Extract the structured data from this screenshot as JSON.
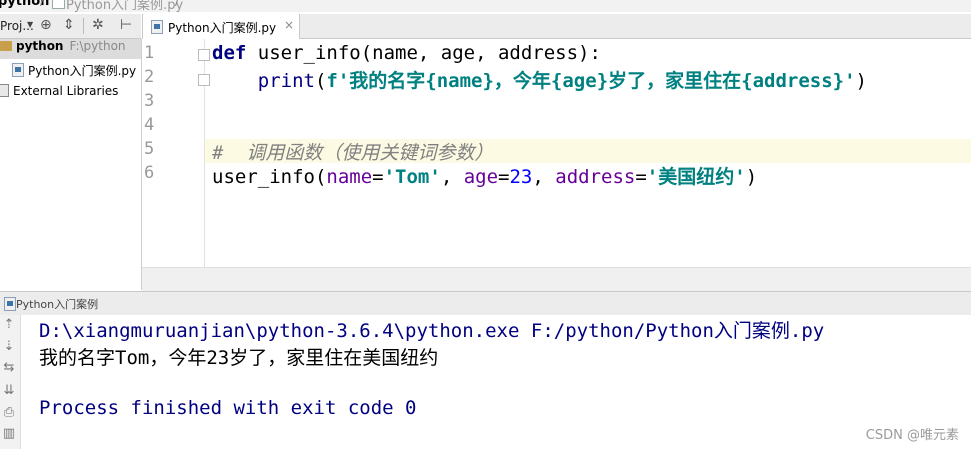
{
  "breadcrumb": {
    "root": "python",
    "separator": "/",
    "file": "Python入门案例.py"
  },
  "project_toolbar": {
    "label": "Proj...",
    "icons": [
      "target-icon",
      "collapse-icon",
      "gear-icon",
      "pin-icon"
    ]
  },
  "tree": {
    "root_name": "python",
    "root_path": "F:\\python",
    "file": "Python入门案例.py",
    "libraries": "External Libraries"
  },
  "editor_tab": {
    "label": "Python入门案例.py",
    "close": "×"
  },
  "editor": {
    "lines": [
      {
        "number": "1",
        "text": "def user_info(name, age, address):"
      },
      {
        "number": "2",
        "text": "    print(f'我的名字{name}，今年{age}岁了，家里住在{address}')"
      },
      {
        "number": "3",
        "text": ""
      },
      {
        "number": "4",
        "text": ""
      },
      {
        "number": "5",
        "text": "#  调用函数（使用关键词参数）"
      },
      {
        "number": "6",
        "text": "user_info(name='Tom', age=23, address='美国纽约')"
      }
    ]
  },
  "run_panel": {
    "title": "Python入门案例",
    "buttons": [
      "up-arrow-icon",
      "down-arrow-icon",
      "wrap-icon",
      "scroll-end-icon",
      "print-icon",
      "trash-icon"
    ],
    "output": [
      "D:\\xiangmuruanjian\\python-3.6.4\\python.exe F:/python/Python入门案例.py",
      "我的名字Tom，今年23岁了，家里住在美国纽约",
      "",
      "Process finished with exit code 0"
    ]
  },
  "watermark": "CSDN @唯元素",
  "colors": {
    "keyword": "#000080",
    "string": "#008080",
    "number": "#0000ff",
    "kwarg": "#660099",
    "comment": "#808080",
    "current_line": "#fcfae3"
  }
}
